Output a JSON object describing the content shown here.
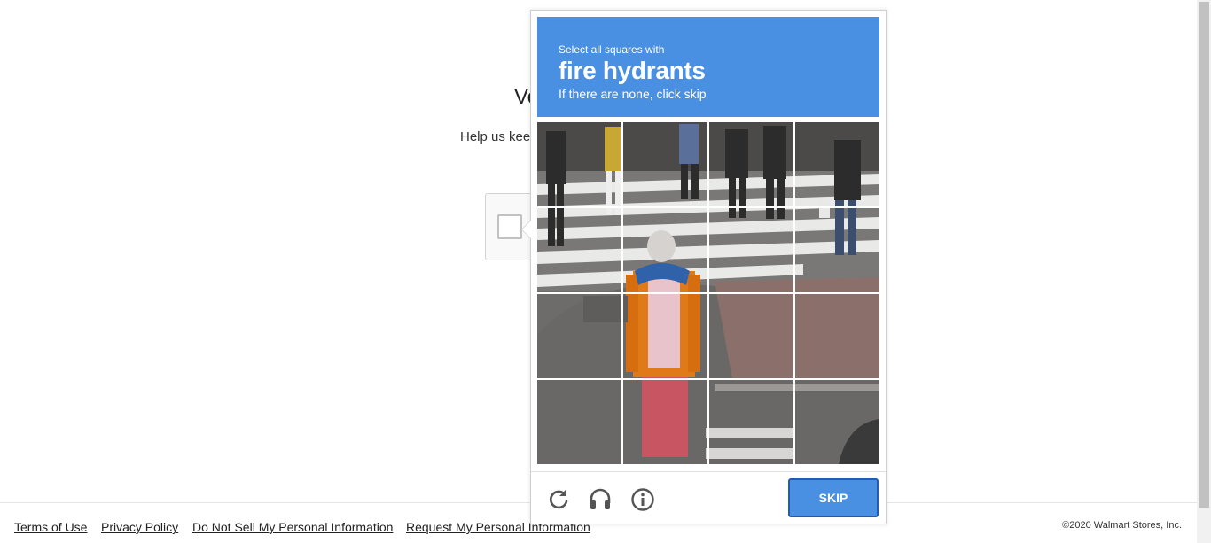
{
  "background_page": {
    "heading": "Ve",
    "subtext": "Help us kee",
    "checkbox_checked": false
  },
  "footer": {
    "links": [
      {
        "label": "Terms of Use"
      },
      {
        "label": "Privacy Policy"
      },
      {
        "label": "Do Not Sell My Personal Information"
      },
      {
        "label": "Request My Personal Information"
      }
    ],
    "copyright": "©2020 Walmart Stores, Inc."
  },
  "challenge": {
    "header": {
      "intro": "Select all squares with",
      "target": "fire hydrants",
      "hint": "If there are none, click skip",
      "color": "#4a90e2"
    },
    "grid": {
      "rows": 4,
      "cols": 4,
      "image_description": "street scene with pedestrians on a crosswalk"
    },
    "controls": {
      "icons": [
        "reload-icon",
        "audio-icon",
        "info-icon"
      ],
      "skip_label": "SKIP"
    }
  }
}
